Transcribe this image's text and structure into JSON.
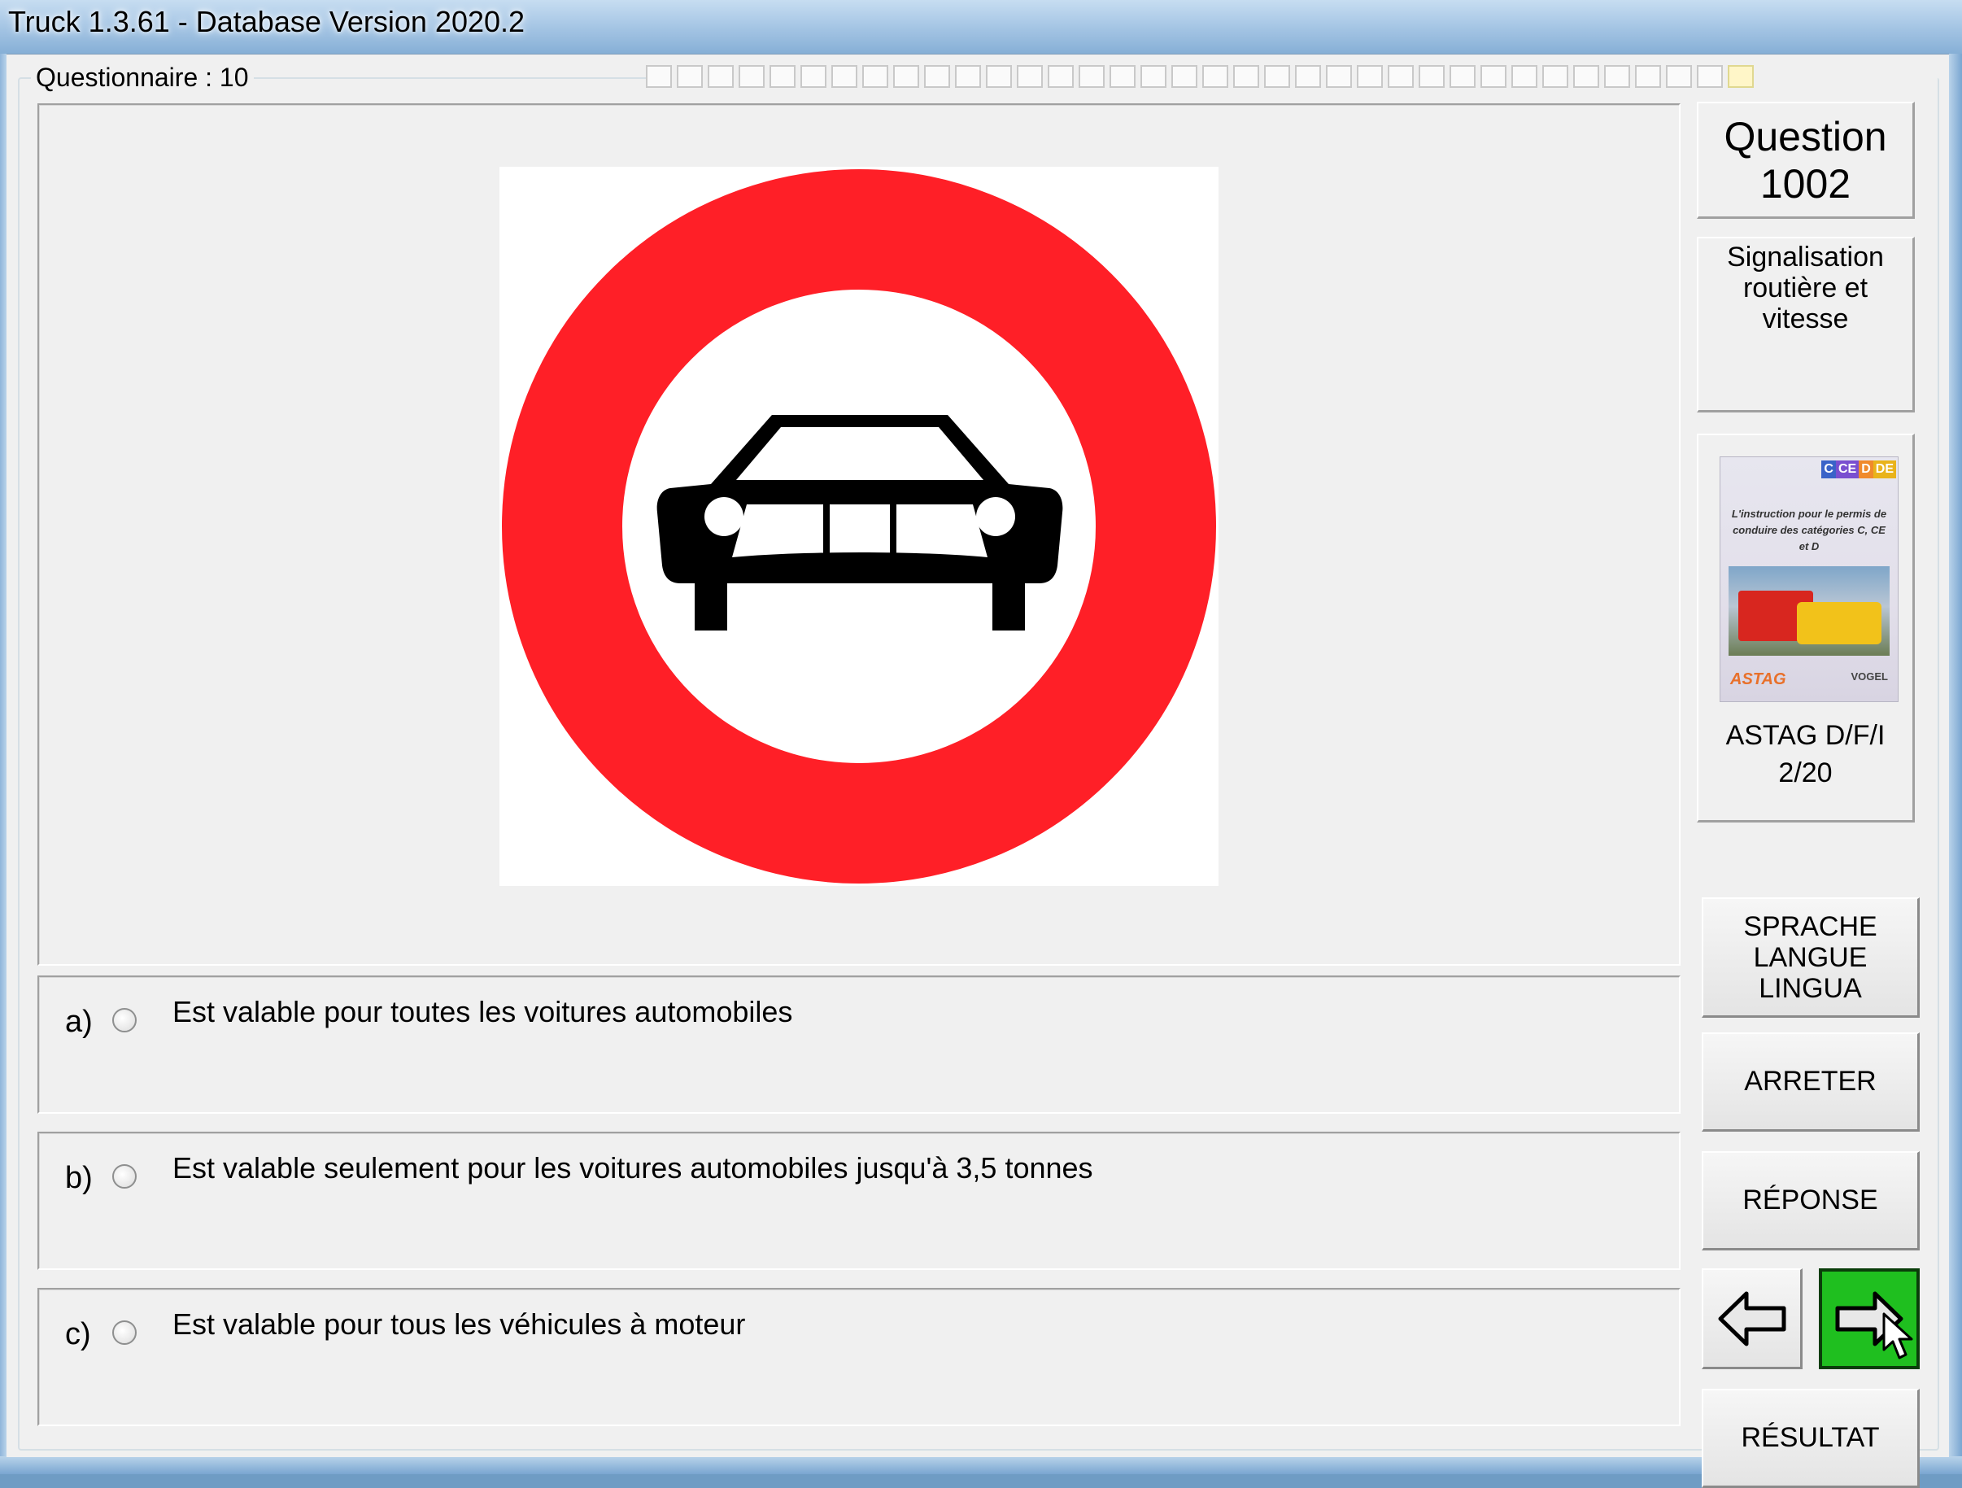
{
  "window": {
    "title": "Truck 1.3.61 - Database Version 2020.2"
  },
  "questionnaire": {
    "label": "Questionnaire : 10",
    "segments": 36,
    "current_segment": 36
  },
  "question": {
    "title_line1": "Question",
    "number": "1002",
    "topic": "Signalisation\nroutière et vitesse"
  },
  "sign": {
    "icon": "no-motor-cars-sign",
    "ring_color": "#ff1f27",
    "symbol_color": "#000000"
  },
  "answers": [
    {
      "letter": "a)",
      "text": "Est valable pour toutes les voitures automobiles"
    },
    {
      "letter": "b)",
      "text": "Est valable seulement pour les voitures automobiles jusqu'à 3,5 tonnes"
    },
    {
      "letter": "c)",
      "text": "Est valable pour tous les véhicules à moteur"
    }
  ],
  "book": {
    "tags": [
      "C",
      "CE",
      "D",
      "DE"
    ],
    "cover_text": "L'instruction pour le permis de conduire des catégories C, CE et D",
    "publisher_left": "ASTAG",
    "publisher_right": "VOGEL",
    "caption_line1": "ASTAG D/F/I",
    "caption_line2": "2/20"
  },
  "buttons": {
    "language": "SPRACHE\nLANGUE\nLINGUA",
    "stop": "ARRETER",
    "answer": "RÉPONSE",
    "result": "RÉSULTAT",
    "prev_icon": "arrow-left-icon",
    "next_icon": "arrow-right-icon"
  },
  "colors": {
    "next_button": "#1fbf1f",
    "sign_red": "#ff1f27"
  }
}
